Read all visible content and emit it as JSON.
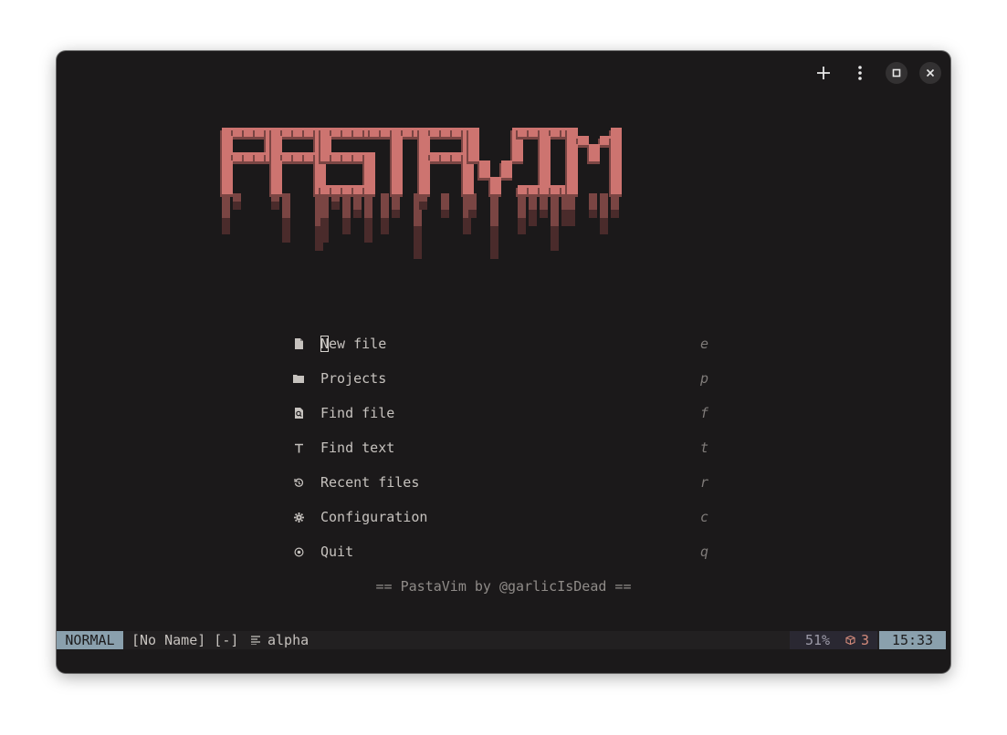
{
  "logo": {
    "text": "PASTAVIM",
    "colors": {
      "light": "#cd7470",
      "mid": "#7a4543",
      "dark": "#4a2b2b"
    }
  },
  "menu": [
    {
      "icon": "file-icon",
      "label": "New file",
      "key": "e"
    },
    {
      "icon": "folder-icon",
      "label": "Projects",
      "key": "p"
    },
    {
      "icon": "search-file-icon",
      "label": "Find file",
      "key": "f"
    },
    {
      "icon": "text-icon",
      "label": "Find text",
      "key": "t"
    },
    {
      "icon": "history-icon",
      "label": "Recent files",
      "key": "r"
    },
    {
      "icon": "gear-icon",
      "label": "Configuration",
      "key": "c"
    },
    {
      "icon": "power-icon",
      "label": "Quit",
      "key": "q"
    }
  ],
  "footer": "== PastaVim by @garlicIsDead ==",
  "statusline": {
    "mode": "NORMAL",
    "filename": "[No Name] [-]",
    "filetype": "alpha",
    "percent": "51%",
    "packages": "3",
    "time": "15:33"
  },
  "colors": {
    "background": "#1b191a",
    "accent": "#8aa0ad",
    "pink": "#cd7470"
  }
}
